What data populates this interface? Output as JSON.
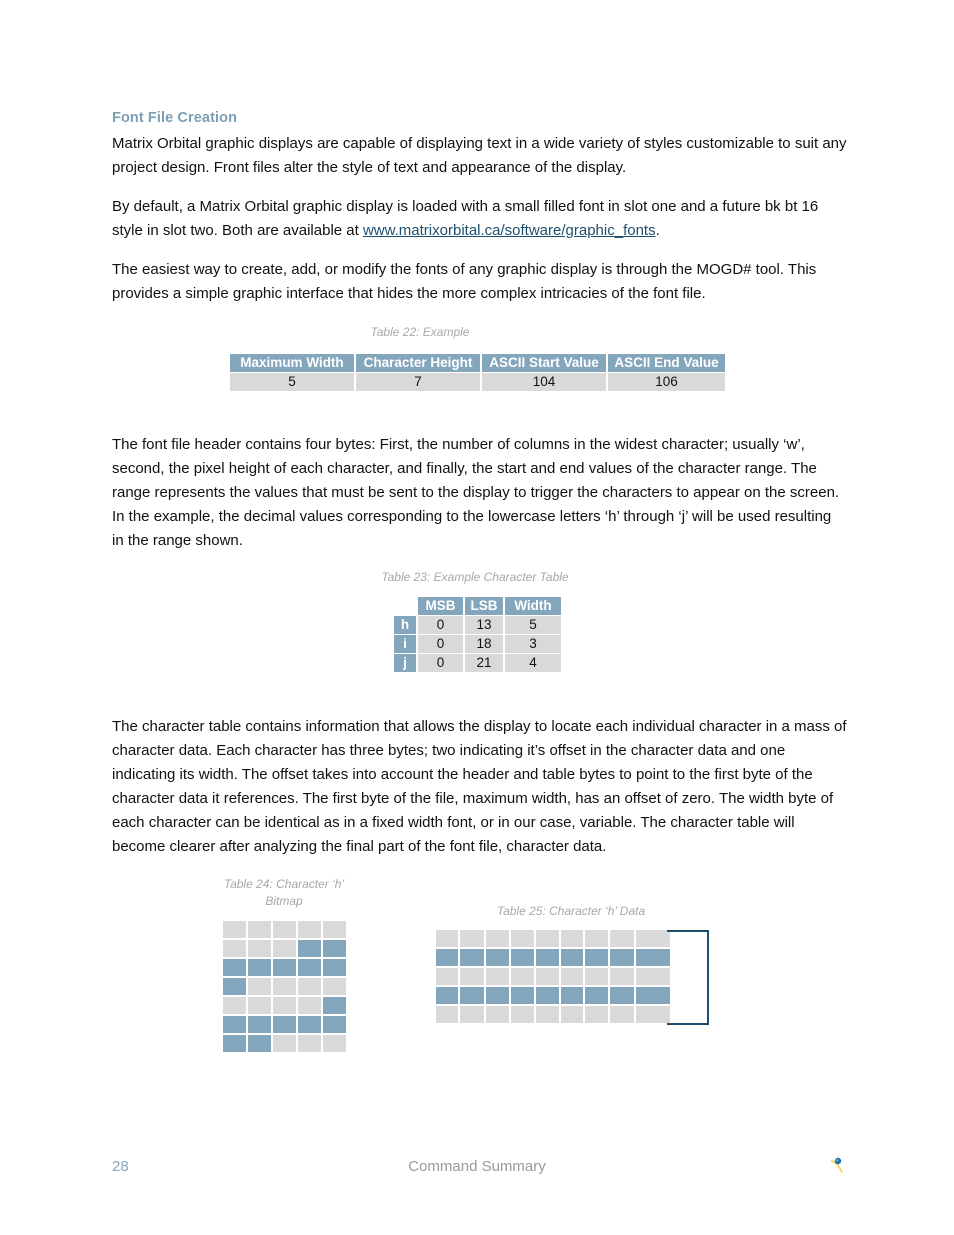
{
  "section": {
    "heading": "Font File Creation"
  },
  "paragraphs": {
    "p1": "Matrix Orbital graphic displays are capable of displaying text in a wide variety of styles customizable to suit any project design.  Front files alter the style of text and appearance of the display.",
    "p2_before_link": "By default, a Matrix Orbital graphic display is loaded with a small filled font in slot one and a future bk bt 16 style in slot two.  Both are available at ",
    "p2_link": "www.matrixorbital.ca/software/graphic_fonts",
    "p2_after_link": ".",
    "p3": "The easiest way to create, add, or modify the fonts of any graphic display is through the MOGD# tool. This provides a simple graphic interface that hides the more complex intricacies of the font file.",
    "p4": "The font file header contains four bytes:  First, the number of columns in the widest character; usually ‘w’, second, the pixel height of each character, and finally, the start and end values of the character range.  The range represents the values that must be sent to the display to trigger the characters to appear on the screen.  In the example, the decimal values corresponding to the lowercase letters ‘h’ through ‘j’ will be used resulting in the range shown.",
    "p5": "The character table contains information that allows the display to locate each individual character in a mass of character data.  Each character has three bytes; two indicating it’s offset in the character data and one indicating its width.  The offset takes into account the header and table bytes to point to the first byte of the character data it references.  The first byte of the file, maximum width, has an offset of zero.  The width byte of each character can be identical as in a fixed width font, or in our case, variable. The character table will become clearer after analyzing the final part of the font file, character data."
  },
  "table22": {
    "caption": "Table 22: Example",
    "headers": [
      "Maximum Width",
      "Character Height",
      "ASCII Start Value",
      "ASCII End Value"
    ],
    "rows": [
      [
        "5",
        "7",
        "104",
        "106"
      ]
    ]
  },
  "table23": {
    "caption": "Table 23: Example Character Table",
    "headers": [
      "MSB",
      "LSB",
      "Width"
    ],
    "rows": [
      {
        "label": "h",
        "values": [
          "0",
          "13",
          "5"
        ]
      },
      {
        "label": "i",
        "values": [
          "0",
          "18",
          "3"
        ]
      },
      {
        "label": "j",
        "values": [
          "0",
          "21",
          "4"
        ]
      }
    ]
  },
  "table24": {
    "caption_line1": "Table 24: Character  ‘h’",
    "caption_line2": "Bitmap",
    "bitmap": [
      [
        0,
        0,
        0,
        0,
        0
      ],
      [
        0,
        0,
        0,
        1,
        1
      ],
      [
        1,
        1,
        1,
        1,
        1
      ],
      [
        1,
        0,
        0,
        0,
        0
      ],
      [
        0,
        0,
        0,
        0,
        1
      ],
      [
        1,
        1,
        1,
        1,
        1
      ],
      [
        1,
        1,
        0,
        0,
        0
      ]
    ]
  },
  "table25": {
    "caption": "Table 25: Character ‘h’ Data",
    "rows": [
      [
        0,
        0,
        0,
        0,
        0,
        0,
        0,
        0,
        0
      ],
      [
        1,
        1,
        1,
        1,
        1,
        1,
        1,
        1,
        1
      ],
      [
        0,
        0,
        0,
        0,
        0,
        0,
        0,
        0,
        0
      ],
      [
        1,
        1,
        1,
        1,
        1,
        1,
        1,
        1,
        1
      ],
      [
        0,
        0,
        0,
        0,
        0,
        0,
        0,
        0,
        0
      ]
    ]
  },
  "footer": {
    "page_number": "28",
    "title": "Command Summary",
    "logo_icon": "matrix-orbital-logo-icon"
  }
}
